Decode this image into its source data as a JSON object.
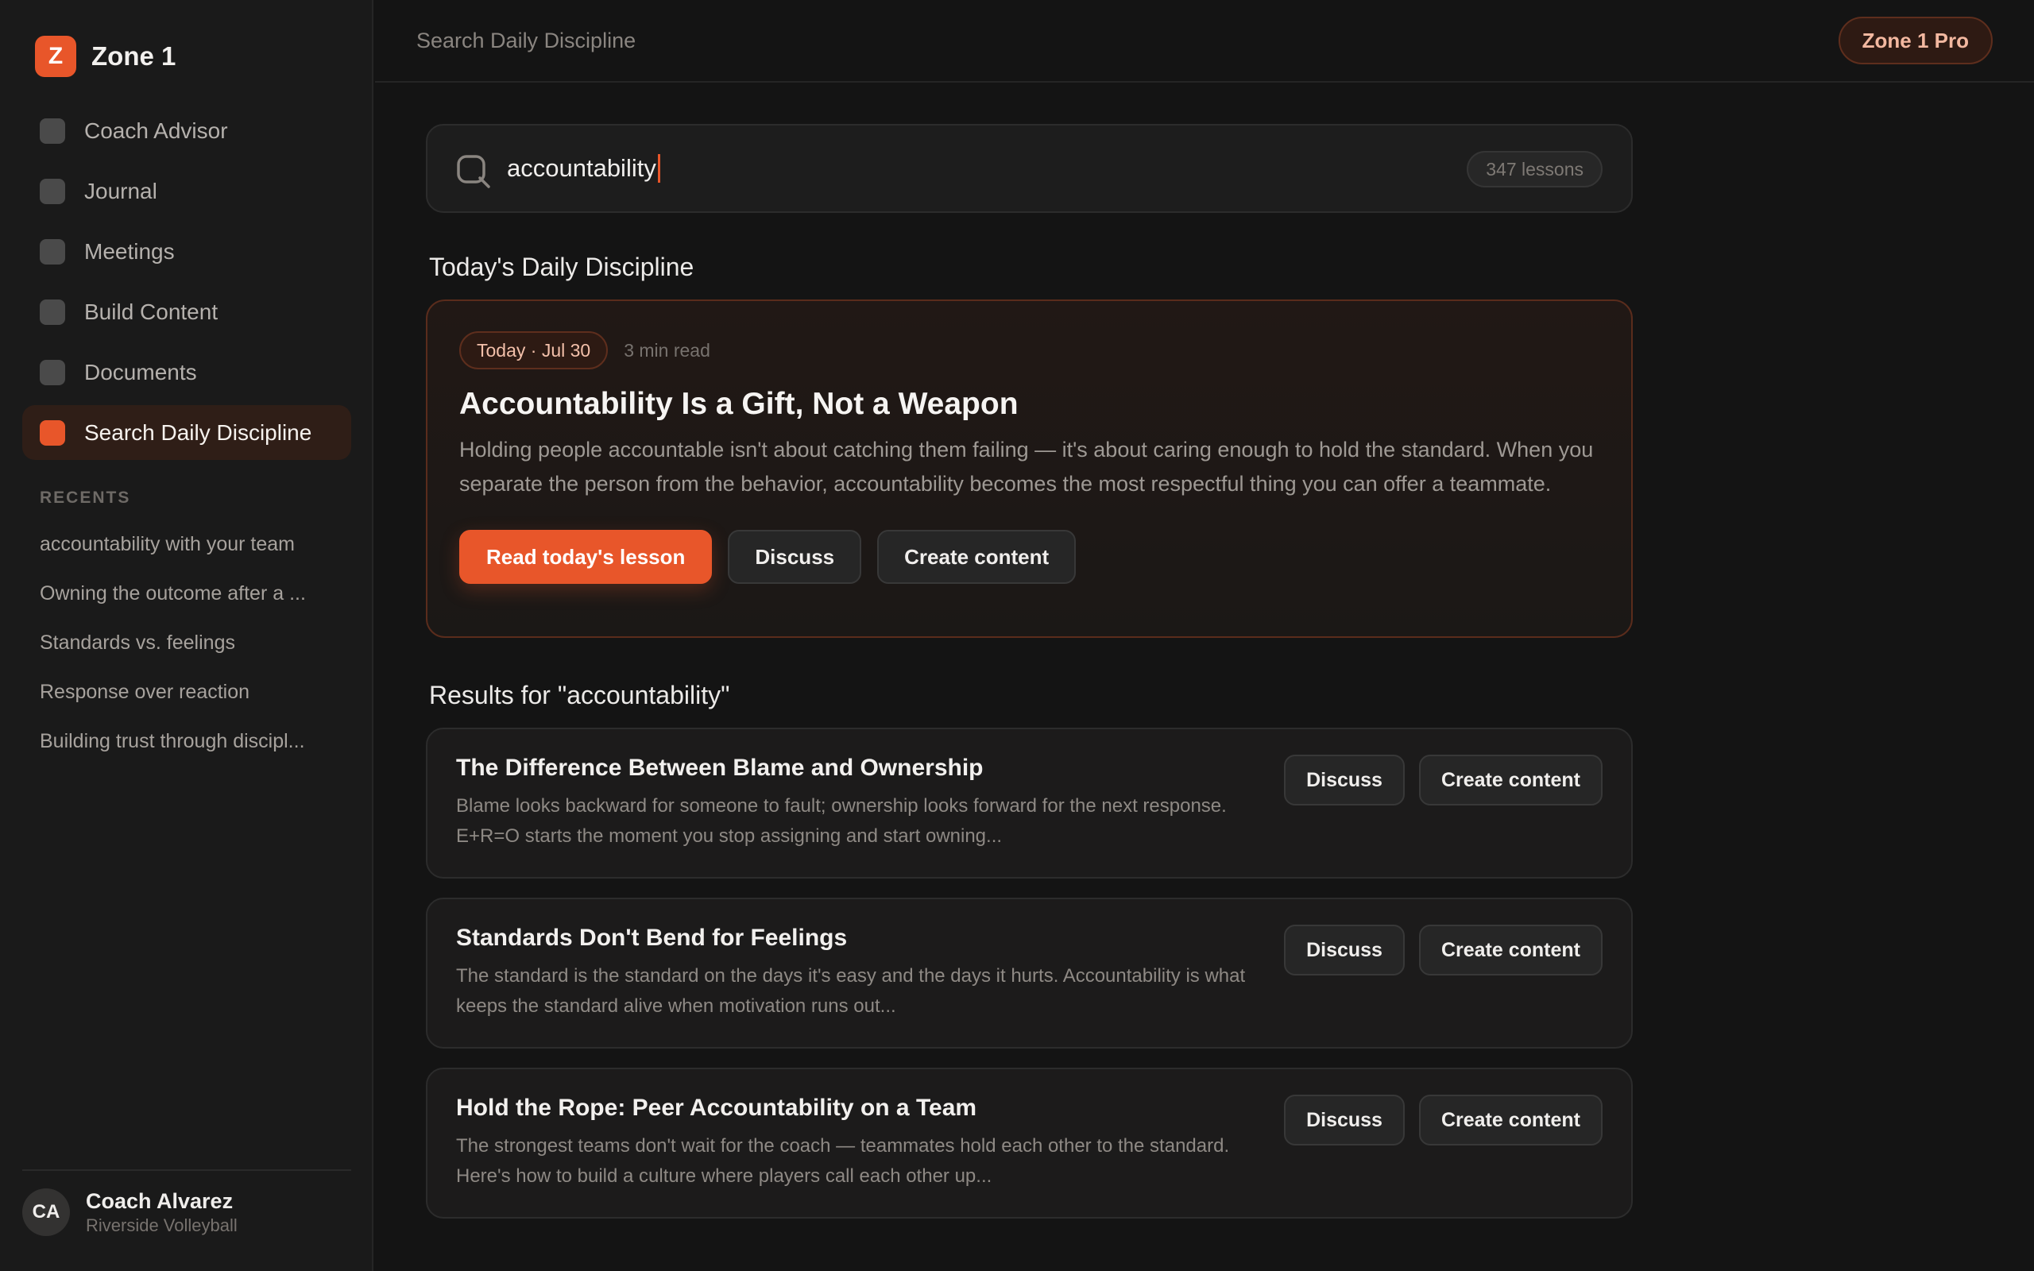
{
  "app": {
    "logo_letter": "Z",
    "name": "Zone 1"
  },
  "sidebar": {
    "items": [
      {
        "label": "Coach Advisor"
      },
      {
        "label": "Journal"
      },
      {
        "label": "Meetings"
      },
      {
        "label": "Build Content"
      },
      {
        "label": "Documents"
      },
      {
        "label": "Search Daily Discipline",
        "active": true
      }
    ],
    "recents_title": "RECENTS",
    "recents": [
      "accountability with your team",
      "Owning the outcome after a ...",
      "Standards vs. feelings",
      "Response over reaction",
      "Building trust through discipl..."
    ],
    "user": {
      "initials": "CA",
      "name": "Coach Alvarez",
      "team": "Riverside Volleyball"
    }
  },
  "topbar": {
    "title": "Search Daily Discipline",
    "badge": "Zone 1 Pro"
  },
  "search": {
    "value": "accountability",
    "count": "347 lessons"
  },
  "today": {
    "section_title": "Today's Daily Discipline",
    "date": "Today · Jul 30",
    "read_time": "3 min read",
    "heading": "Accountability Is a Gift, Not a Weapon",
    "body": "Holding people accountable isn't about catching them failing — it's about caring enough to hold the standard. When you separate the person from the behavior, accountability becomes the most respectful thing you can offer a teammate.",
    "primary_button": "Read today's lesson",
    "discuss_button": "Discuss",
    "create_button": "Create content"
  },
  "results": {
    "section_title": "Results for \"accountability\"",
    "discuss_label": "Discuss",
    "create_label": "Create content",
    "items": [
      {
        "title": "The Difference Between Blame and Ownership",
        "body": "Blame looks backward for someone to fault; ownership looks forward for the next response. E+R=O starts the moment you stop assigning and start owning..."
      },
      {
        "title": "Standards Don't Bend for Feelings",
        "body": "The standard is the standard on the days it's easy and the days it hurts. Accountability is what keeps the standard alive when motivation runs out..."
      },
      {
        "title": "Hold the Rope: Peer Accountability on a Team",
        "body": "The strongest teams don't wait for the coach — teammates hold each other to the standard. Here's how to build a culture where players call each other up..."
      }
    ]
  },
  "colors": {
    "accent": "#E8562A",
    "background": "#141414",
    "sidebar": "#1A1A1A"
  },
  "icons": {
    "search": "search-icon",
    "nav": "nav-square-icon"
  }
}
